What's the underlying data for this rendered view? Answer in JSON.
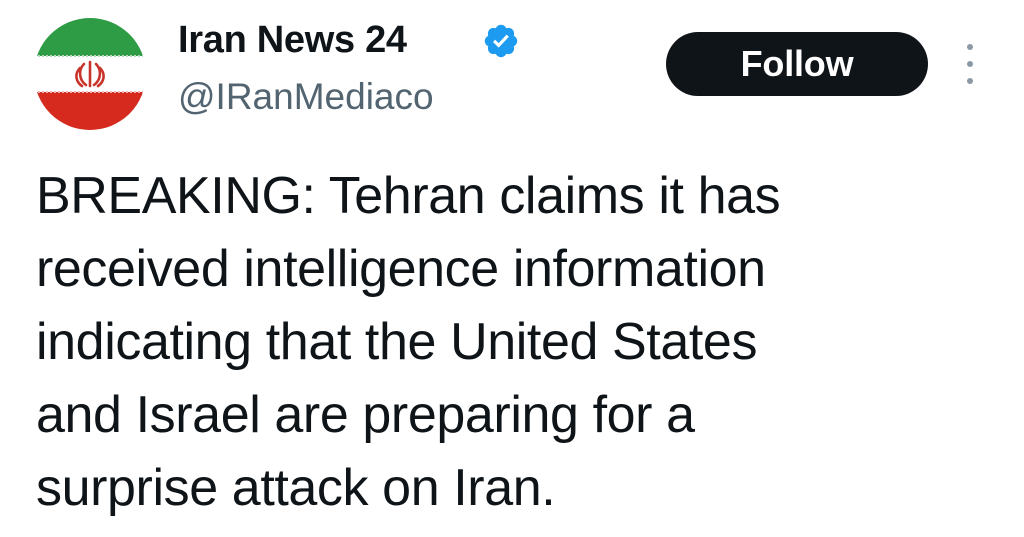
{
  "author": {
    "display_name": "Iran News 24",
    "handle": "@IRanMediaco",
    "verified_icon": "verified-badge-icon",
    "avatar_icon": "iran-flag-avatar"
  },
  "actions": {
    "follow_label": "Follow",
    "more_icon": "more-vertical-icon"
  },
  "tweet": {
    "lines": [
      "BREAKING: Tehran claims it has",
      "received intelligence information",
      "indicating that the United States",
      "and Israel are preparing for a",
      "surprise attack on Iran."
    ]
  },
  "colors": {
    "text": "#0f1419",
    "handle": "#536471",
    "button_bg": "#0f1419",
    "button_text": "#ffffff",
    "verified": "#1d9bf0",
    "flag_green": "#239f40",
    "flag_white": "#ffffff",
    "flag_red": "#da0000"
  }
}
